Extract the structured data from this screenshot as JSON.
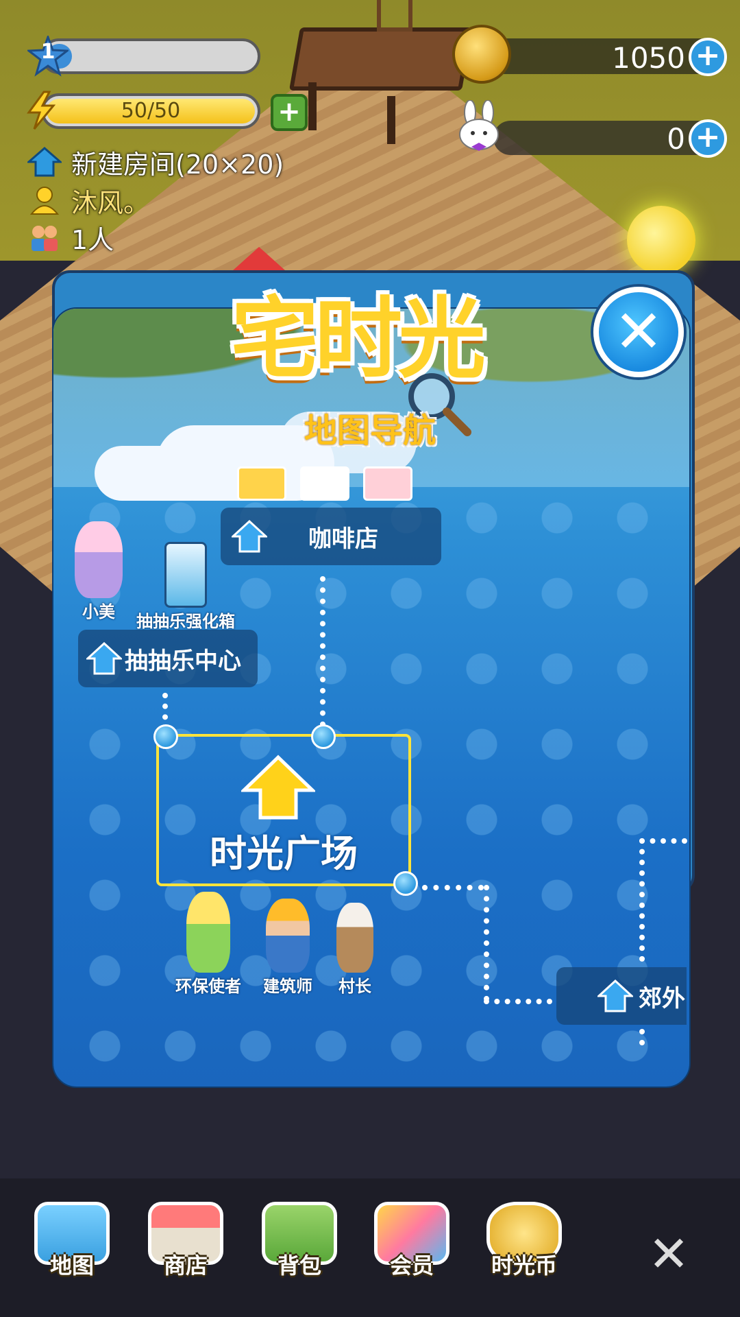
{
  "hud": {
    "level": "1",
    "level_progress": 0.12,
    "energy": "50/50",
    "energy_add": "+",
    "coins": "1050",
    "coin_add": "+",
    "gems": "0",
    "gem_add": "+"
  },
  "room_info": {
    "room_name": "新建房间(20×20)",
    "owner": "沐风。",
    "visitors": "1人"
  },
  "map_dialog": {
    "title": "宅时光",
    "subtitle": "地图导航",
    "close": "✕",
    "locations": {
      "cafe": "咖啡店",
      "lottery_center": "抽抽乐中心",
      "plaza": "时光广场",
      "suburb": "郊外"
    },
    "npcs": {
      "xiaomei": "小美",
      "lottery_box": "抽抽乐强化箱",
      "eco": "环保使者",
      "architect": "建筑师",
      "chief": "村长"
    },
    "shop_icons": [
      "vip-icon",
      "medic-icon",
      "hair-salon-icon"
    ]
  },
  "bottom_nav": {
    "items": [
      {
        "label": "地图",
        "icon": "map-icon"
      },
      {
        "label": "商店",
        "icon": "shop-icon"
      },
      {
        "label": "背包",
        "icon": "backpack-icon"
      },
      {
        "label": "会员",
        "icon": "vip-member-icon"
      },
      {
        "label": "时光币",
        "icon": "time-coin-icon"
      }
    ],
    "close": "✕"
  },
  "colors": {
    "accent_blue": "#2e9ae0",
    "gold": "#ffd22a",
    "plaza_border": "#ffe33a"
  }
}
